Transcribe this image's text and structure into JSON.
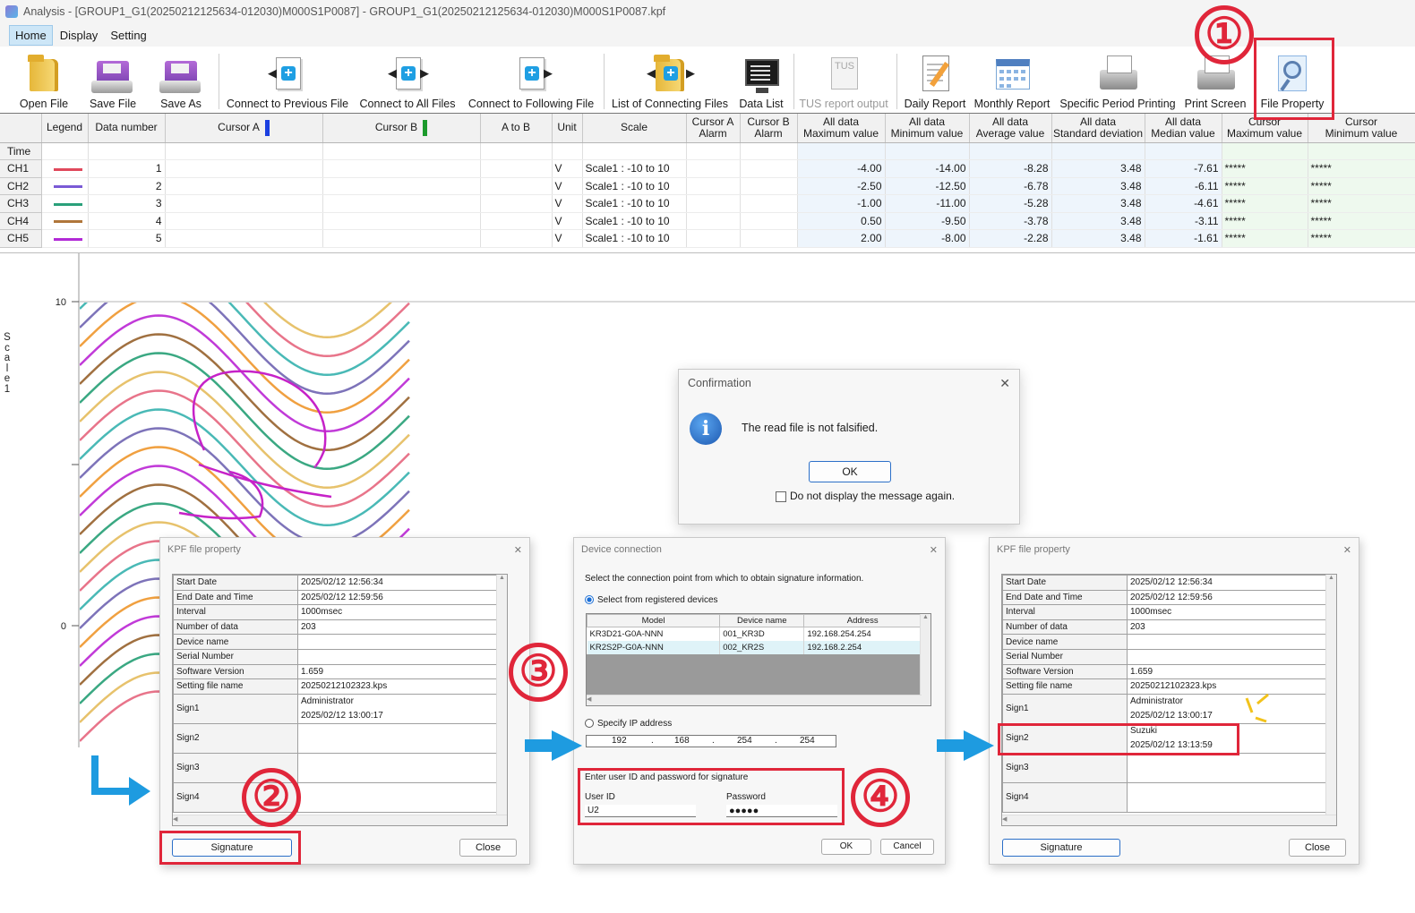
{
  "window": {
    "title": "Analysis - [GROUP1_G1(20250212125634-012030)M000S1P0087] - GROUP1_G1(20250212125634-012030)M000S1P0087.kpf"
  },
  "menu": {
    "items": [
      "Home",
      "Display",
      "Setting"
    ]
  },
  "toolbar": {
    "open_file": "Open File",
    "save_file": "Save File",
    "save_as": "Save As",
    "connect_prev": "Connect to Previous File",
    "connect_all": "Connect to All Files",
    "connect_next": "Connect to Following File",
    "list_connecting": "List of Connecting Files",
    "data_list": "Data List",
    "tus_icon_text": "TUS",
    "tus_output": "TUS report output",
    "daily_report": "Daily Report",
    "monthly_report": "Monthly Report",
    "specific_period": "Specific Period Printing",
    "print_screen": "Print Screen",
    "file_property": "File Property"
  },
  "table": {
    "headers": {
      "legend": "Legend",
      "data_number": "Data number",
      "cursor_a": "Cursor A",
      "cursor_b": "Cursor B",
      "a_to_b": "A to B",
      "unit": "Unit",
      "scale": "Scale",
      "cursor_a_alarm_1": "Cursor A",
      "cursor_a_alarm_2": "Alarm",
      "cursor_b_alarm_1": "Cursor B",
      "cursor_b_alarm_2": "Alarm",
      "max_1": "All data",
      "max_2": "Maximum value",
      "min_1": "All data",
      "min_2": "Minimum value",
      "avg_1": "All data",
      "avg_2": "Average value",
      "std_1": "All data",
      "std_2": "Standard deviation",
      "median_1": "All data",
      "median_2": "Median value",
      "cmax_1": "Cursor",
      "cmax_2": "Maximum value",
      "cmin_1": "Cursor",
      "cmin_2": "Minimum value"
    },
    "time_row": "Time",
    "rows": [
      {
        "ch": "CH1",
        "color": "#e0495c",
        "num": "1",
        "unit": "V",
        "scale": "Scale1 : -10 to 10",
        "max": "-4.00",
        "min": "-14.00",
        "avg": "-8.28",
        "std": "3.48",
        "median": "-7.61",
        "cmax": "*****",
        "cmin": "*****"
      },
      {
        "ch": "CH2",
        "color": "#7a5ad6",
        "num": "2",
        "unit": "V",
        "scale": "Scale1 : -10 to 10",
        "max": "-2.50",
        "min": "-12.50",
        "avg": "-6.78",
        "std": "3.48",
        "median": "-6.11",
        "cmax": "*****",
        "cmin": "*****"
      },
      {
        "ch": "CH3",
        "color": "#2aa07a",
        "num": "3",
        "unit": "V",
        "scale": "Scale1 : -10 to 10",
        "max": "-1.00",
        "min": "-11.00",
        "avg": "-5.28",
        "std": "3.48",
        "median": "-4.61",
        "cmax": "*****",
        "cmin": "*****"
      },
      {
        "ch": "CH4",
        "color": "#b0763a",
        "num": "4",
        "unit": "V",
        "scale": "Scale1 : -10 to 10",
        "max": "0.50",
        "min": "-9.50",
        "avg": "-3.78",
        "std": "3.48",
        "median": "-3.11",
        "cmax": "*****",
        "cmin": "*****"
      },
      {
        "ch": "CH5",
        "color": "#b22ad6",
        "num": "5",
        "unit": "V",
        "scale": "Scale1 : -10 to 10",
        "max": "2.00",
        "min": "-8.00",
        "avg": "-2.28",
        "std": "3.48",
        "median": "-1.61",
        "cmax": "*****",
        "cmin": "*****"
      }
    ],
    "cursor_a_color": "#1b3fe0",
    "cursor_b_color": "#1c9a2c"
  },
  "chart": {
    "tick_top": "10",
    "tick_mid": "0",
    "axis_label": "Scale1"
  },
  "confirm": {
    "title": "Confirmation",
    "message": "The read file is not falsified.",
    "ok": "OK",
    "dont_show": "Do not display the message again."
  },
  "prop_before": {
    "title": "KPF file property",
    "rows": [
      {
        "key": "Start Date",
        "val": "2025/02/12 12:56:34"
      },
      {
        "key": "End Date and Time",
        "val": "2025/02/12 12:59:56"
      },
      {
        "key": "Interval",
        "val": "1000msec"
      },
      {
        "key": "Number of data",
        "val": "203"
      },
      {
        "key": "Device name",
        "val": ""
      },
      {
        "key": "Serial Number",
        "val": ""
      },
      {
        "key": "Software Version",
        "val": "1.659"
      },
      {
        "key": "Setting file name",
        "val": "20250212102323.kps"
      }
    ],
    "sign1": "Sign1",
    "sign1_user": "Administrator",
    "sign1_time": "2025/02/12 13:00:17",
    "sign2": "Sign2",
    "sign3": "Sign3",
    "sign4": "Sign4",
    "signature_btn": "Signature",
    "close_btn": "Close"
  },
  "device": {
    "title": "Device connection",
    "instruction": "Select the connection point from which to obtain signature information.",
    "registered": "Select from registered devices",
    "headers": [
      "Model",
      "Device name",
      "Address"
    ],
    "rows": [
      [
        "KR3D21-G0A-NNN",
        "001_KR3D",
        "192.168.254.254"
      ],
      [
        "KR2S2P-G0A-NNN",
        "002_KR2S",
        "192.168.2.254"
      ]
    ],
    "specify_ip": "Specify IP address",
    "ip": [
      "192",
      "168",
      "254",
      "254"
    ],
    "ip_dot": ".",
    "credentials_title": "Enter user ID and password for signature",
    "user_label": "User ID",
    "user_value": "U2",
    "pass_label": "Password",
    "pass_value": "●●●●●",
    "ok": "OK",
    "cancel": "Cancel"
  },
  "prop_after": {
    "title": "KPF file property",
    "sign2_user": "Suzuki",
    "sign2_time": "2025/02/12 13:13:59"
  },
  "annotations": {
    "step1": "①",
    "step2": "②",
    "step3": "③",
    "step4": "④"
  },
  "colors": {
    "highlight": "#e0263a",
    "arrow": "#1e9be0"
  }
}
